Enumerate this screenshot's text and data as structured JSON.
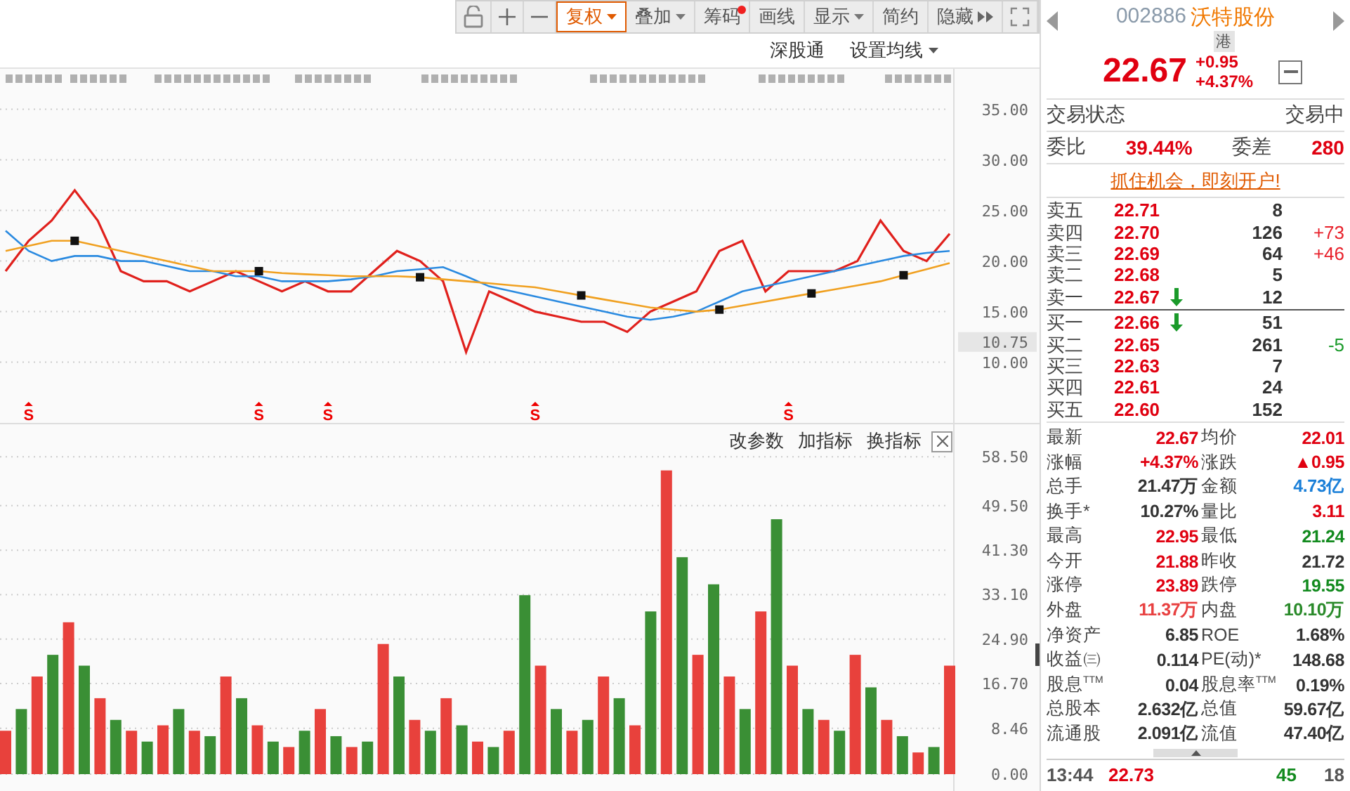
{
  "toolbar": [
    {
      "label": "复权",
      "kind": "dropdown",
      "selected": true
    },
    {
      "label": "叠加",
      "kind": "dropdown",
      "selected": false
    },
    {
      "label": "筹码",
      "kind": "dot",
      "selected": false
    },
    {
      "label": "画线",
      "kind": "plain",
      "selected": false
    },
    {
      "label": "显示",
      "kind": "dropdown",
      "selected": false
    },
    {
      "label": "简约",
      "kind": "plain",
      "selected": false
    },
    {
      "label": "隐藏",
      "kind": "more",
      "selected": false
    }
  ],
  "chart_links": [
    {
      "label": "深股通",
      "kind": "plain"
    },
    {
      "label": "设置均线",
      "kind": "dropdown"
    }
  ],
  "price_chart": {
    "cursor_label": "10.75",
    "signals": [
      "S",
      "S",
      "S",
      "S",
      "S"
    ],
    "chart_data": {
      "type": "line",
      "ylim": [
        4,
        39
      ],
      "grid": true,
      "yticks": [
        {
          "value": 10,
          "label": "10.00"
        },
        {
          "value": 15,
          "label": "15.00"
        },
        {
          "value": 20,
          "label": "20.00"
        },
        {
          "value": 25,
          "label": "25.00"
        },
        {
          "value": 30,
          "label": "30.00"
        },
        {
          "value": 35,
          "label": "35.00"
        }
      ],
      "series": [
        {
          "color": "#e0201c",
          "values": [
            19,
            22,
            24,
            27,
            24,
            19,
            18,
            18,
            17,
            18,
            19,
            18,
            17,
            18,
            17,
            17,
            19,
            21,
            20,
            18,
            11,
            17,
            16,
            15,
            14.5,
            14,
            14,
            13,
            15,
            16,
            17,
            21,
            22,
            17,
            19,
            19,
            19,
            20,
            24,
            21,
            20,
            22.7
          ]
        },
        {
          "color": "#2a8ae0",
          "values": [
            23,
            21,
            20,
            20.5,
            20.5,
            20,
            20,
            19.5,
            19,
            19,
            18.5,
            18.5,
            18,
            18,
            18,
            18.2,
            18.5,
            19,
            19.2,
            19.4,
            18.5,
            17.5,
            17,
            16.5,
            16,
            15.5,
            15,
            14.5,
            14.2,
            14.5,
            15,
            16,
            17,
            17.5,
            18,
            18.5,
            19,
            19.5,
            20,
            20.5,
            20.8,
            21
          ]
        },
        {
          "color": "#f0a020",
          "values": [
            21,
            21.5,
            22,
            22,
            21.5,
            21,
            20.5,
            20,
            19.5,
            19,
            19,
            19,
            18.8,
            18.7,
            18.6,
            18.5,
            18.5,
            18.5,
            18.4,
            18.2,
            18,
            17.8,
            17.6,
            17.4,
            17,
            16.6,
            16.2,
            15.8,
            15.4,
            15.2,
            15,
            15.2,
            15.6,
            16,
            16.4,
            16.8,
            17.2,
            17.6,
            18,
            18.6,
            19.2,
            19.8
          ]
        }
      ]
    }
  },
  "volume_chart": {
    "actions": [
      "改参数",
      "加指标",
      "换指标"
    ],
    "chart_data": {
      "type": "bar",
      "ylim": [
        0,
        64.5
      ],
      "grid": true,
      "yticks": [
        {
          "value": 0,
          "label": "0.00"
        },
        {
          "value": 8.46,
          "label": "8.46"
        },
        {
          "value": 16.7,
          "label": "16.70"
        },
        {
          "value": 24.9,
          "label": "24.90"
        },
        {
          "value": 33.1,
          "label": "33.10"
        },
        {
          "value": 41.3,
          "label": "41.30"
        },
        {
          "value": 49.5,
          "label": "49.50"
        },
        {
          "value": 58.5,
          "label": "58.50"
        }
      ],
      "series": [
        {
          "color": "#e8413c",
          "values": [
            8,
            null,
            18,
            null,
            28,
            null,
            14,
            null,
            8,
            null,
            9,
            null,
            8,
            null,
            18,
            null,
            9,
            null,
            5,
            null,
            12,
            null,
            5,
            null,
            24,
            null,
            10,
            null,
            14,
            null,
            6,
            null,
            8,
            null,
            20,
            null,
            8,
            null,
            18,
            null,
            9,
            null,
            56,
            null,
            22,
            null,
            18,
            null,
            30,
            null,
            20,
            null,
            10,
            null,
            22,
            null,
            10,
            null,
            4,
            null,
            20
          ]
        },
        {
          "color": "#3a8f35",
          "values": [
            null,
            12,
            null,
            22,
            null,
            20,
            null,
            10,
            null,
            6,
            null,
            12,
            null,
            7,
            null,
            14,
            null,
            6,
            null,
            8,
            null,
            7,
            null,
            6,
            null,
            18,
            null,
            8,
            null,
            9,
            null,
            5,
            null,
            33,
            null,
            12,
            null,
            10,
            null,
            14,
            null,
            30,
            null,
            40,
            null,
            35,
            null,
            12,
            null,
            47,
            null,
            12,
            null,
            8,
            null,
            16,
            null,
            7,
            null,
            5,
            null
          ]
        }
      ]
    }
  },
  "quote": {
    "code": "002886",
    "name": "沃特股份",
    "badge": "港",
    "price": "22.67",
    "change": "+0.95",
    "change_pct": "+4.37%"
  },
  "status": {
    "label": "交易状态",
    "value": "交易中"
  },
  "ratio": {
    "label": "委比",
    "value": "39.44%",
    "diff_label": "委差",
    "diff_value": "280"
  },
  "promo": "抓住机会，即刻开户!",
  "asks": [
    {
      "label": "卖五",
      "price": "22.71",
      "volume": "8",
      "arrow": false
    },
    {
      "label": "卖四",
      "price": "22.70",
      "volume": "126",
      "arrow": false,
      "delta": "+73",
      "color": "#e8202a"
    },
    {
      "label": "卖三",
      "price": "22.69",
      "volume": "64",
      "arrow": false,
      "delta": "+46",
      "color": "#e8202a"
    },
    {
      "label": "卖二",
      "price": "22.68",
      "volume": "5",
      "arrow": false
    },
    {
      "label": "卖一",
      "price": "22.67",
      "volume": "12",
      "arrow": true
    }
  ],
  "bids": [
    {
      "label": "买一",
      "price": "22.66",
      "volume": "51",
      "arrow": true
    },
    {
      "label": "买二",
      "price": "22.65",
      "volume": "261",
      "arrow": false,
      "delta": "-5",
      "color": "#1a9a2a"
    },
    {
      "label": "买三",
      "price": "22.63",
      "volume": "7",
      "arrow": false
    },
    {
      "label": "买四",
      "price": "22.61",
      "volume": "24",
      "arrow": false
    },
    {
      "label": "买五",
      "price": "22.60",
      "volume": "152",
      "arrow": false
    }
  ],
  "stats": [
    {
      "label": "最新",
      "value": "22.67",
      "color": "#e00010"
    },
    {
      "label": "均价",
      "value": "22.01",
      "color": "#e00010"
    },
    {
      "label": "涨幅",
      "value": "+4.37%",
      "color": "#e00010"
    },
    {
      "label": "涨跌",
      "value": "▲0.95",
      "color": "#e00010"
    },
    {
      "label": "总手",
      "value": "21.47万",
      "color": "#333333"
    },
    {
      "label": "金额",
      "value": "4.73亿",
      "color": "#1a7fd8"
    },
    {
      "label": "换手*",
      "value": "10.27%",
      "color": "#333333"
    },
    {
      "label": "量比",
      "value": "3.11",
      "color": "#e00010"
    },
    {
      "label": "最高",
      "value": "22.95",
      "color": "#e00010"
    },
    {
      "label": "最低",
      "value": "21.24",
      "color": "#128a1e"
    },
    {
      "label": "今开",
      "value": "21.88",
      "color": "#e00010"
    },
    {
      "label": "昨收",
      "value": "21.72",
      "color": "#333333"
    },
    {
      "label": "涨停",
      "value": "23.89",
      "color": "#e00010"
    },
    {
      "label": "跌停",
      "value": "19.55",
      "color": "#128a1e"
    },
    {
      "label": "外盘",
      "value": "11.37万",
      "color": "#e84040"
    },
    {
      "label": "内盘",
      "value": "10.10万",
      "color": "#2a8a2a"
    },
    {
      "label": "净资产",
      "value": "6.85",
      "color": "#333333"
    },
    {
      "label": "ROE",
      "value": "1.68%",
      "color": "#333333"
    },
    {
      "label": "收益㈢",
      "value": "0.114",
      "color": "#333333"
    },
    {
      "label": "PE(动)*",
      "value": "148.68",
      "color": "#333333"
    },
    {
      "label": "股息$^{TTM}$",
      "value": "0.04",
      "color": "#333333"
    },
    {
      "label": "股息率$^{TTM}$",
      "value": "0.19%",
      "color": "#333333"
    },
    {
      "label": "总股本",
      "value": "2.632亿",
      "color": "#333333"
    },
    {
      "label": "总值",
      "value": "59.67亿",
      "color": "#333333"
    },
    {
      "label": "流通股",
      "value": "2.091亿",
      "color": "#333333"
    },
    {
      "label": "流值",
      "value": "47.40亿",
      "color": "#333333"
    }
  ],
  "last_trade": {
    "time": "13:44",
    "price": "22.73",
    "volume": "45",
    "count": "18"
  }
}
